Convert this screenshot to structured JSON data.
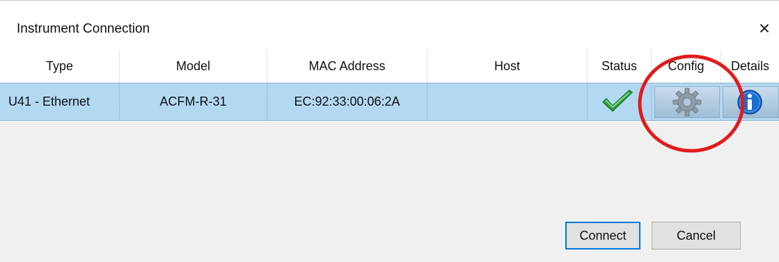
{
  "window": {
    "title": "Instrument Connection",
    "close_glyph": "×"
  },
  "table": {
    "columns": [
      "Type",
      "Model",
      "MAC Address",
      "Host",
      "Status",
      "Config",
      "Details"
    ],
    "rows": [
      {
        "type": "U41 - Ethernet",
        "model": "ACFM-R-31",
        "mac": "EC:92:33:00:06:2A",
        "host": "",
        "status_icon": "checkmark-icon",
        "config_icon": "gear-icon",
        "details_icon": "info-icon"
      }
    ]
  },
  "buttons": {
    "connect": "Connect",
    "cancel": "Cancel"
  },
  "colors": {
    "selection": "#b3d8f2",
    "check": "#2e9e3f",
    "info": "#1a6fd1",
    "annotation": "#e11b1b"
  }
}
